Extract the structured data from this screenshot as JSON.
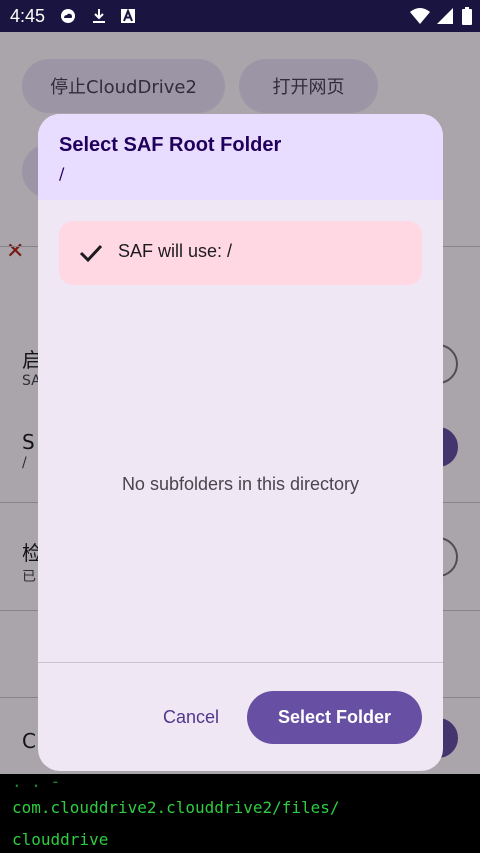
{
  "status_bar": {
    "time": "4:45",
    "icons": [
      "cloud-icon",
      "download-icon",
      "a-box-icon",
      "wifi-icon",
      "signal-icon",
      "battery-icon"
    ]
  },
  "background_app": {
    "stop_button": "停止CloudDrive2",
    "open_web_button": "打开网页",
    "row1_label": "启",
    "row1_sub": "SA",
    "row2_label": "S",
    "row2_sub": "/",
    "row3_label": "检",
    "row3_sub": "已",
    "row4_label": "C"
  },
  "console": {
    "lines": [
      "com.clouddrive2.clouddrive2/files/",
      "clouddrive"
    ]
  },
  "dialog": {
    "title": "Select SAF Root Folder",
    "path": "/",
    "banner_text": "SAF will use: /",
    "empty_message": "No subfolders in this directory",
    "cancel_label": "Cancel",
    "select_label": "Select Folder"
  },
  "colors": {
    "primary": "#6750a4",
    "header_bg": "#e9ddff",
    "banner_bg": "#ffd8e4",
    "console_text": "#2ecc40"
  }
}
